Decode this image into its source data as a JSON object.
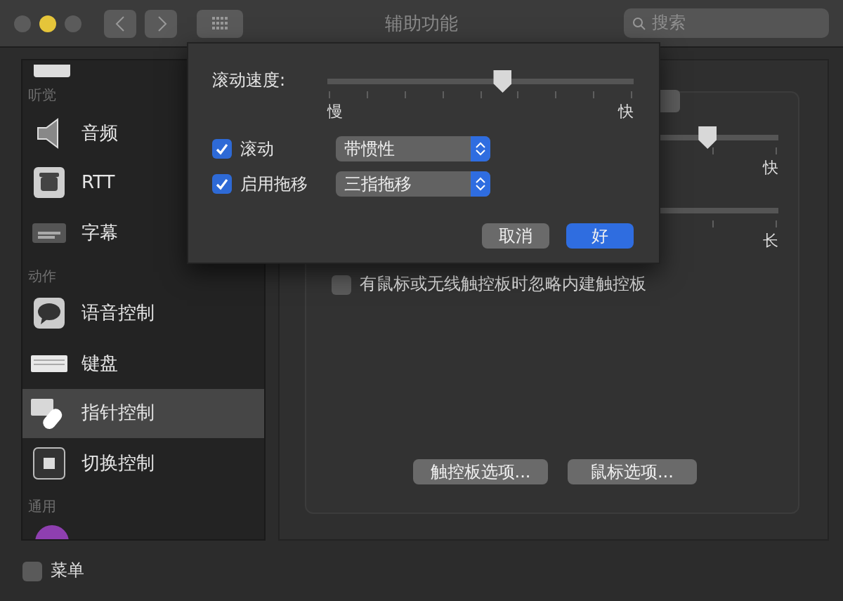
{
  "window": {
    "title": "辅助功能"
  },
  "search": {
    "placeholder": "搜索"
  },
  "sidebar": {
    "groups": [
      {
        "header": "听觉",
        "items": [
          {
            "label": "音频",
            "selected": false
          },
          {
            "label": "RTT",
            "selected": false
          },
          {
            "label": "字幕",
            "selected": false
          }
        ]
      },
      {
        "header": "动作",
        "items": [
          {
            "label": "语音控制",
            "selected": false
          },
          {
            "label": "键盘",
            "selected": false
          },
          {
            "label": "指针控制",
            "selected": true
          },
          {
            "label": "切换控制",
            "selected": false
          }
        ]
      },
      {
        "header": "通用"
      }
    ]
  },
  "main": {
    "sliders": [
      {
        "end_label": "快",
        "level": 0.84
      },
      {
        "end_label": "长"
      }
    ],
    "ignore_trackpad": {
      "label": "有鼠标或无线触控板时忽略内建触控板",
      "checked": false
    },
    "buttons": [
      "触控板选项...",
      "鼠标选项..."
    ]
  },
  "bottom_bar": {
    "label": "菜单",
    "checked": false
  },
  "sheet": {
    "speed": {
      "label": "滚动速度:",
      "min_label": "慢",
      "max_label": "快",
      "level": 0.57
    },
    "options": [
      {
        "label": "滚动",
        "checked": true,
        "value": "带惯性"
      },
      {
        "label": "启用拖移",
        "checked": true,
        "value": "三指拖移"
      }
    ],
    "buttons": [
      {
        "label": "取消",
        "kind": "cancel"
      },
      {
        "label": "好",
        "kind": "default"
      }
    ]
  }
}
